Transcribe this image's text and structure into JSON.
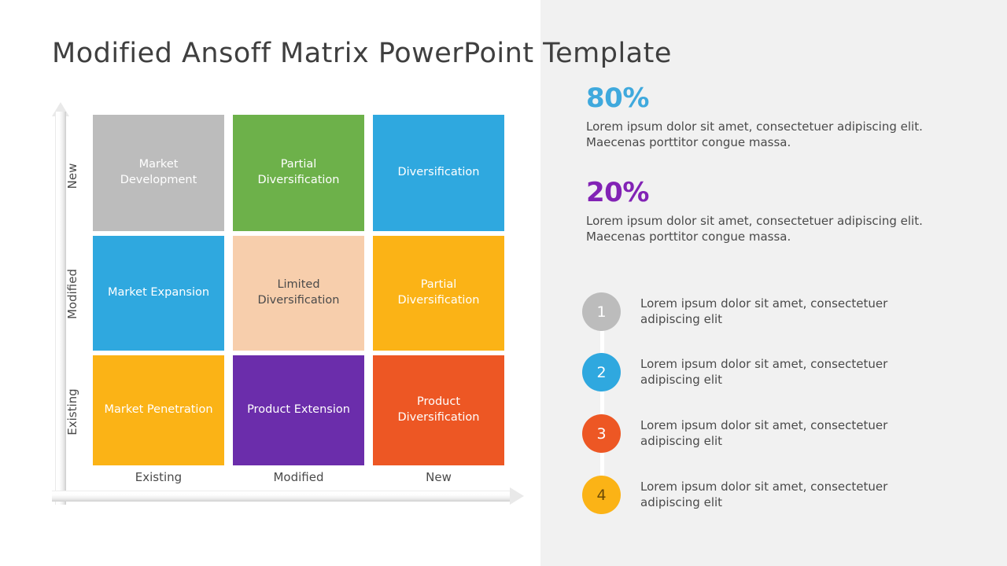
{
  "page": {
    "title": "Modified Ansoff Matrix PowerPoint Template",
    "background": "#ffffff",
    "panel_background": "#f1f1f1"
  },
  "matrix": {
    "y_axis": {
      "arrow": "up-arrow",
      "labels": [
        "New",
        "Modified",
        "Existing"
      ]
    },
    "x_axis": {
      "arrow": "right-arrow",
      "labels": [
        "Existing",
        "Modified",
        "New"
      ]
    },
    "cells": [
      {
        "label": "Market Development",
        "color": "#bcbcbc",
        "text_color": "#ffffff",
        "row": 0,
        "col": 0
      },
      {
        "label": "Partial Diversification",
        "color": "#6db14a",
        "text_color": "#ffffff",
        "row": 0,
        "col": 1
      },
      {
        "label": "Diversification",
        "color": "#2fa8df",
        "text_color": "#ffffff",
        "row": 0,
        "col": 2
      },
      {
        "label": "Market Expansion",
        "color": "#2fa8df",
        "text_color": "#ffffff",
        "row": 1,
        "col": 0
      },
      {
        "label": "Limited Diversification",
        "color": "#f7ceac",
        "text_color": "#4a4a4a",
        "row": 1,
        "col": 1
      },
      {
        "label": "Partial Diversification",
        "color": "#fbb316",
        "text_color": "#ffffff",
        "row": 1,
        "col": 2
      },
      {
        "label": "Market Penetration",
        "color": "#fbb316",
        "text_color": "#ffffff",
        "row": 2,
        "col": 0
      },
      {
        "label": "Product Extension",
        "color": "#6b2dab",
        "text_color": "#ffffff",
        "row": 2,
        "col": 1
      },
      {
        "label": "Product Diversification",
        "color": "#ed5724",
        "text_color": "#ffffff",
        "row": 2,
        "col": 2
      }
    ]
  },
  "stats": [
    {
      "value": "80%",
      "color": "#3fa9dd",
      "description": "Lorem ipsum dolor sit amet, consectetuer adipiscing elit. Maecenas porttitor congue massa."
    },
    {
      "value": "20%",
      "color": "#8223b5",
      "description": "Lorem ipsum dolor sit amet, consectetuer adipiscing elit. Maecenas porttitor congue massa."
    }
  ],
  "list": {
    "connector_color": "#ffffff",
    "items": [
      {
        "number": "1",
        "color": "#bcbcbc",
        "number_color": "#ffffff",
        "text": "Lorem ipsum dolor sit amet, consectetuer adipiscing elit"
      },
      {
        "number": "2",
        "color": "#2fa8df",
        "number_color": "#ffffff",
        "text": "Lorem ipsum dolor sit amet, consectetuer adipiscing elit"
      },
      {
        "number": "3",
        "color": "#ed5724",
        "number_color": "#ffffff",
        "text": "Lorem ipsum dolor sit amet, consectetuer adipiscing elit"
      },
      {
        "number": "4",
        "color": "#fbb316",
        "number_color": "#6b4a06",
        "text": "Lorem ipsum dolor sit amet, consectetuer adipiscing elit"
      }
    ]
  }
}
